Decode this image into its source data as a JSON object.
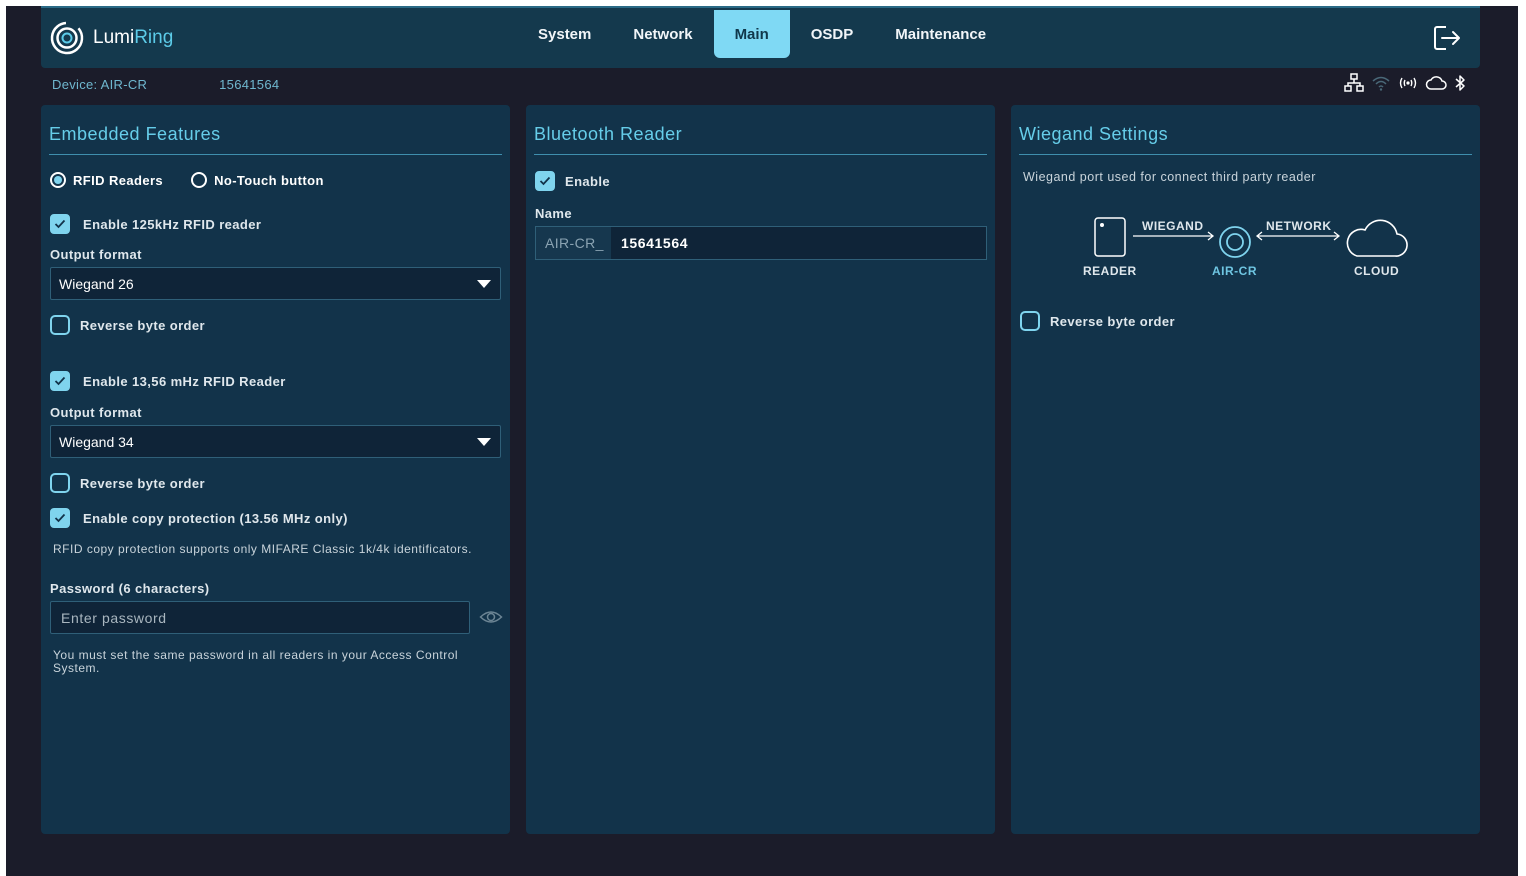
{
  "brand": {
    "name_part1": "Lumi",
    "name_part2": "Ring"
  },
  "nav": {
    "tabs": [
      {
        "label": "System",
        "active": false
      },
      {
        "label": "Network",
        "active": false
      },
      {
        "label": "Main",
        "active": true
      },
      {
        "label": "OSDP",
        "active": false
      },
      {
        "label": "Maintenance",
        "active": false
      }
    ]
  },
  "device": {
    "label": "Device: AIR-CR",
    "serial": "15641564"
  },
  "status_icons": [
    "network-icon",
    "wifi-icon",
    "nfc-icon",
    "cloud-icon",
    "bluetooth-icon"
  ],
  "embedded": {
    "title": "Embedded Features",
    "mode_options": [
      {
        "label": "RFID Readers",
        "selected": true
      },
      {
        "label": "No-Touch button",
        "selected": false
      }
    ],
    "rfid125": {
      "enable_label": "Enable 125kHz RFID reader",
      "enabled": true,
      "output_label": "Output format",
      "output_value": "Wiegand 26",
      "reverse_label": "Reverse byte order",
      "reverse": false
    },
    "rfid1356": {
      "enable_label": "Enable 13,56 mHz RFID Reader",
      "enabled": true,
      "output_label": "Output format",
      "output_value": "Wiegand 34",
      "reverse_label": "Reverse byte order",
      "reverse": false
    },
    "copy_protection": {
      "label": "Enable copy protection (13.56 MHz only)",
      "enabled": true,
      "note": "RFID copy protection supports only MIFARE Classic 1k/4k identificators.",
      "password_label": "Password (6 characters)",
      "password_placeholder": "Enter password",
      "password_note": "You must set the same password in all readers in your Access Control System."
    }
  },
  "bluetooth": {
    "title": "Bluetooth Reader",
    "enable_label": "Enable",
    "enabled": true,
    "name_label": "Name",
    "name_prefix": "AIR-CR_",
    "name_value": "15641564"
  },
  "wiegand": {
    "title": "Wiegand Settings",
    "description": "Wiegand port used for connect third party reader",
    "diagram": {
      "reader": "READER",
      "device": "AIR-CR",
      "cloud": "CLOUD",
      "link1": "WIEGAND",
      "link2": "NETWORK"
    },
    "reverse_label": "Reverse byte order",
    "reverse": false
  },
  "colors": {
    "accent": "#7fd4ee",
    "panel": "#12334a",
    "background": "#1b1c2a",
    "title": "#66cde9"
  }
}
